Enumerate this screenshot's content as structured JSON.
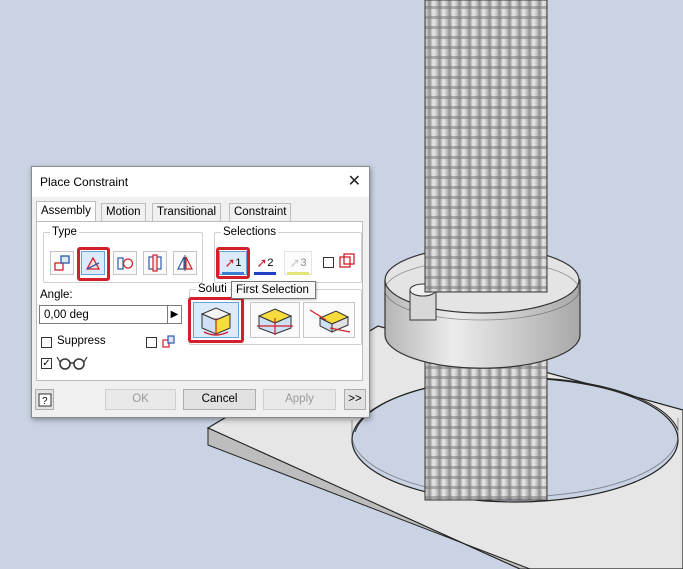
{
  "dialog": {
    "title": "Place Constraint",
    "tabs": [
      "Assembly",
      "Motion",
      "Transitional",
      "Constraint Set"
    ],
    "type_label": "Type",
    "selections_label": "Selections",
    "selection_1": "1",
    "selection_2": "2",
    "selection_3": "3",
    "angle_label": "Angle:",
    "angle_value": "0,00 deg",
    "solution_label": "Soluti",
    "suppress_label": "Suppress",
    "ok_label": "OK",
    "cancel_label": "Cancel",
    "apply_label": "Apply",
    "expand_label": ">>"
  },
  "tooltip": {
    "text": "First Selection"
  },
  "colors": {
    "accent_red": "#d31f2b",
    "viewport_bg": "#c9d3e4",
    "selected_blue": "#dcebfb"
  }
}
